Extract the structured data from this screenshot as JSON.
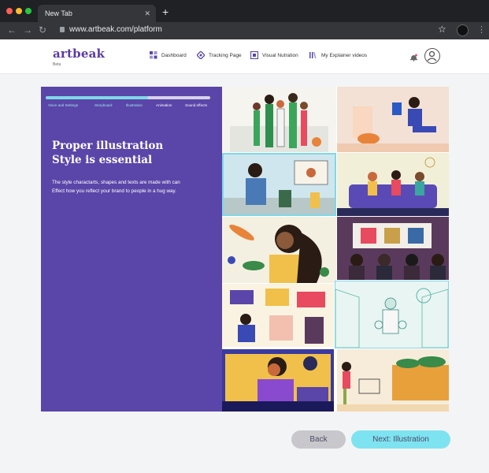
{
  "browser": {
    "tab_title": "New Tab",
    "tab_close": "✕",
    "new_tab": "+",
    "url": "www.artbeak.com/platform"
  },
  "header": {
    "logo": "artbeak",
    "beta": "Beta",
    "nav": [
      {
        "label": "Dashboard"
      },
      {
        "label": "Tracking Page"
      },
      {
        "label": "Visual Nutration"
      },
      {
        "label": "My Explainer videos"
      }
    ]
  },
  "stepper": {
    "progress": 0.62,
    "steps": [
      {
        "label": "Voice and Settings",
        "state": "done"
      },
      {
        "label": "Storyboard",
        "state": "done"
      },
      {
        "label": "Illustration",
        "state": "active"
      },
      {
        "label": "Animation",
        "state": "todo"
      },
      {
        "label": "Sound effects",
        "state": "todo"
      }
    ]
  },
  "content": {
    "headline_line1": "Proper illustration",
    "headline_line2": "Style is essential",
    "desc_line1": "The style charactarts, shapes and texts are made with can",
    "desc_line2": "Effect how you reflect your brand to people in a hug way."
  },
  "gallery": {
    "tiles": [
      {
        "name": "team-group",
        "bg": "#f6f4ef"
      },
      {
        "name": "reader-with-cat",
        "bg": "#f3e1d5"
      },
      {
        "name": "street-scene",
        "bg": "#cfe6ee"
      },
      {
        "name": "living-room",
        "bg": "#f2efd8"
      },
      {
        "name": "woman-vegetables",
        "bg": "#f4f0e1"
      },
      {
        "name": "conference",
        "bg": "#5a3a5c"
      },
      {
        "name": "workspace",
        "bg": "#faf3e2"
      },
      {
        "name": "cyclists-city",
        "bg": "#e8f5f2"
      },
      {
        "name": "woman-laptop",
        "bg": "#3a3aa0"
      },
      {
        "name": "grocery-shopping",
        "bg": "#f7ecd9"
      }
    ]
  },
  "buttons": {
    "back": "Back",
    "next": "Next: Illustration"
  },
  "colors": {
    "accent": "#5a45a8",
    "next_button": "#7ee3f0",
    "back_button": "#c8c8cc"
  }
}
